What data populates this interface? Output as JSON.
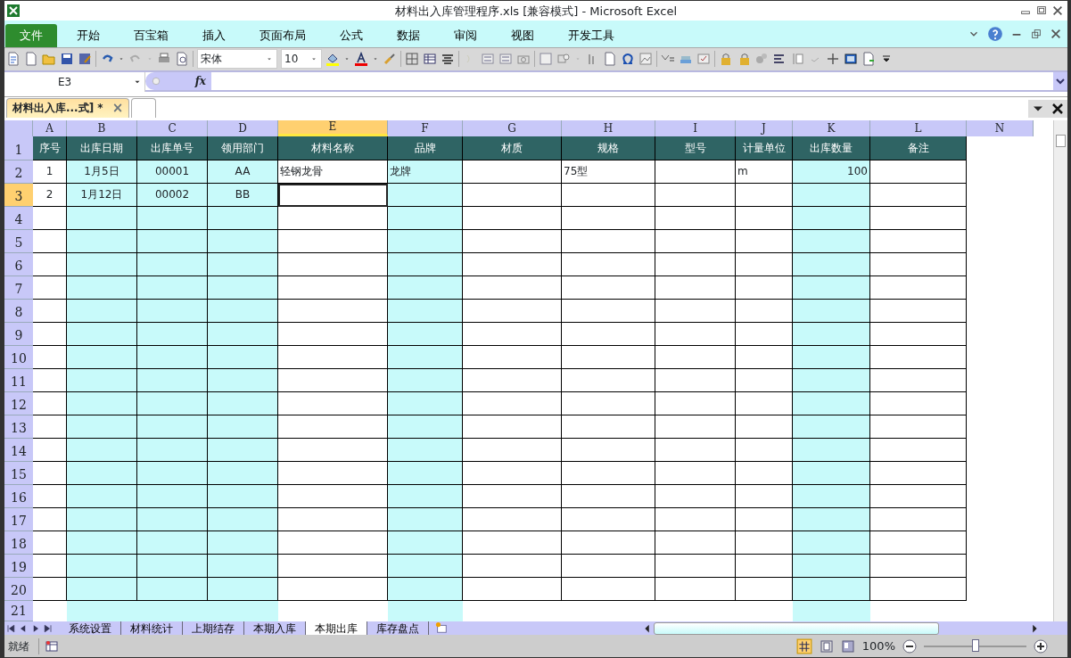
{
  "window": {
    "title": "材料出入库管理程序.xls  [兼容模式]  -  Microsoft Excel"
  },
  "ribbon_tabs": [
    {
      "label": "文件",
      "selected": true
    },
    {
      "label": "开始",
      "selected": false
    },
    {
      "label": "百宝箱",
      "selected": false
    },
    {
      "label": "插入",
      "selected": false
    },
    {
      "label": "页面布局",
      "selected": false
    },
    {
      "label": "公式",
      "selected": false
    },
    {
      "label": "数据",
      "selected": false
    },
    {
      "label": "审阅",
      "selected": false
    },
    {
      "label": "视图",
      "selected": false
    },
    {
      "label": "开发工具",
      "selected": false
    }
  ],
  "toolbar": {
    "font": "宋体",
    "size": "10"
  },
  "formula_bar": {
    "name_box": "E3",
    "fx": "fx"
  },
  "doc_tabs": [
    {
      "label": "材料出入库...式] *",
      "selected": true,
      "close": "×"
    },
    {
      "selected": false
    }
  ],
  "columns": [
    {
      "letter": "A",
      "selected": false
    },
    {
      "letter": "B",
      "selected": false,
      "shaded": true
    },
    {
      "letter": "C",
      "selected": false,
      "shaded": true
    },
    {
      "letter": "D",
      "selected": false,
      "shaded": true
    },
    {
      "letter": "E",
      "selected": true
    },
    {
      "letter": "F",
      "selected": false,
      "shaded": true
    },
    {
      "letter": "G",
      "selected": false
    },
    {
      "letter": "H",
      "selected": false
    },
    {
      "letter": "I",
      "selected": false
    },
    {
      "letter": "J",
      "selected": false
    },
    {
      "letter": "K",
      "selected": false,
      "shaded": true
    },
    {
      "letter": "L",
      "selected": false
    },
    {
      "letter": "N",
      "selected": false
    }
  ],
  "header_row": {
    "number": "1",
    "cells": [
      "序号",
      "出库日期",
      "出库单号",
      "领用部门",
      "材料名称",
      "品牌",
      "材质",
      "规格",
      "型号",
      "计量单位",
      "出库数量",
      "备注"
    ]
  },
  "rows": [
    {
      "number": "2",
      "selected": false,
      "cells": {
        "A": "1",
        "B": "1月5日",
        "C": "00001",
        "D": "AA",
        "E": "轻钢龙骨",
        "F": "龙牌",
        "H": "75型",
        "J": "m",
        "K": "100"
      }
    },
    {
      "number": "3",
      "selected": true,
      "cells": {
        "A": "2",
        "B": "1月12日",
        "C": "00002",
        "D": "BB"
      }
    },
    {
      "number": "4",
      "selected": false
    },
    {
      "number": "5",
      "selected": false
    },
    {
      "number": "6",
      "selected": false
    },
    {
      "number": "7",
      "selected": false
    },
    {
      "number": "8",
      "selected": false
    },
    {
      "number": "9",
      "selected": false
    },
    {
      "number": "10",
      "selected": false
    },
    {
      "number": "11",
      "selected": false
    },
    {
      "number": "12",
      "selected": false
    },
    {
      "number": "13",
      "selected": false
    },
    {
      "number": "14",
      "selected": false
    },
    {
      "number": "15",
      "selected": false
    },
    {
      "number": "16",
      "selected": false
    },
    {
      "number": "17",
      "selected": false
    },
    {
      "number": "18",
      "selected": false
    },
    {
      "number": "19",
      "selected": false
    },
    {
      "number": "20",
      "selected": false
    },
    {
      "number": "21",
      "selected": false,
      "partial": true
    }
  ],
  "sheet_tabs": [
    {
      "label": "系统设置",
      "selected": false
    },
    {
      "label": "材料统计",
      "selected": false
    },
    {
      "label": "上期结存",
      "selected": false
    },
    {
      "label": "本期入库",
      "selected": false
    },
    {
      "label": "本期出库",
      "selected": true
    },
    {
      "label": "库存盘点",
      "selected": false
    }
  ],
  "status_bar": {
    "status": "就绪",
    "zoom": "100%",
    "zoom_slider": {
      "level": 0.5
    }
  }
}
